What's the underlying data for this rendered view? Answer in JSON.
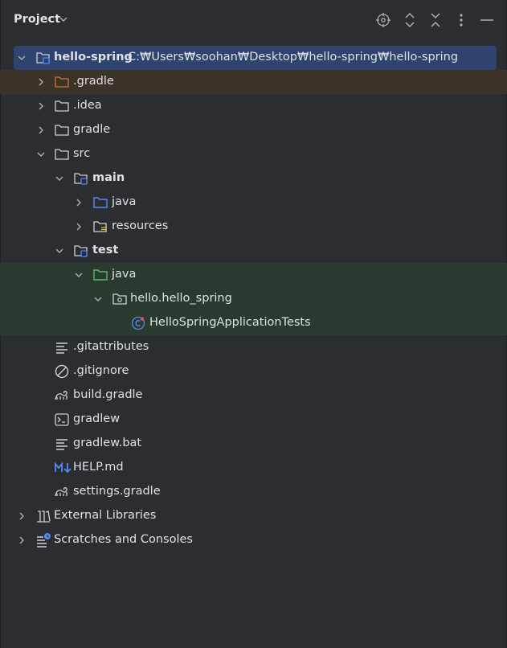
{
  "header": {
    "title": "Project",
    "icons": [
      "chevron-down-icon",
      "locate-icon",
      "expand-all-icon",
      "collapse-all-icon",
      "more-icon",
      "minimize-icon"
    ]
  },
  "tree": {
    "root": {
      "name": "hello-spring",
      "path": "C:₩Users₩soohan₩Desktop₩hello-spring₩hello-spring"
    },
    "items": [
      {
        "label": ".gradle"
      },
      {
        "label": ".idea"
      },
      {
        "label": "gradle"
      },
      {
        "label": "src"
      },
      {
        "label": "main"
      },
      {
        "label": "java"
      },
      {
        "label": "resources"
      },
      {
        "label": "test"
      },
      {
        "label": "java"
      },
      {
        "label": "hello.hello_spring"
      },
      {
        "label": "HelloSpringApplicationTests"
      },
      {
        "label": ".gitattributes"
      },
      {
        "label": ".gitignore"
      },
      {
        "label": "build.gradle"
      },
      {
        "label": "gradlew"
      },
      {
        "label": "gradlew.bat"
      },
      {
        "label": "HELP.md"
      },
      {
        "label": "settings.gradle"
      },
      {
        "label": "External Libraries"
      },
      {
        "label": "Scratches and Consoles"
      }
    ]
  },
  "colors": {
    "background": "#2b2d30",
    "selection": "#2e436e",
    "excluded_row": "#3b3228",
    "test_row": "#2b3a2e",
    "excluded_folder": "#c7753c",
    "source_folder": "#548af7",
    "test_folder": "#5fb865",
    "markdown": "#548af7"
  }
}
